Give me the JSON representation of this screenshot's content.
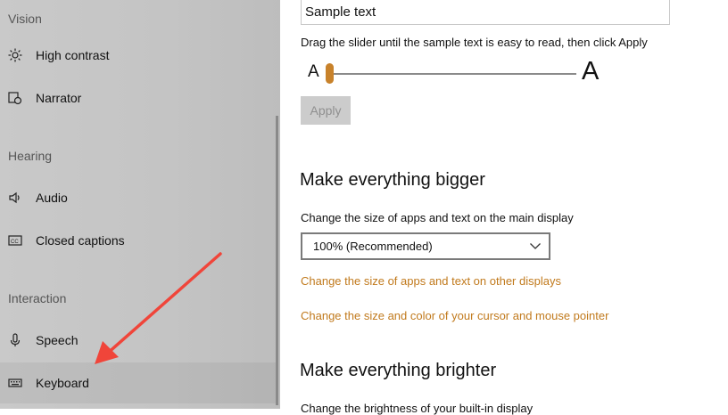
{
  "sidebar": {
    "sections": {
      "vision": "Vision",
      "hearing": "Hearing",
      "interaction": "Interaction"
    },
    "items": [
      {
        "label": "High contrast",
        "icon": "sun-icon"
      },
      {
        "label": "Narrator",
        "icon": "narrator-icon"
      },
      {
        "label": "Audio",
        "icon": "speaker-icon"
      },
      {
        "label": "Closed captions",
        "icon": "cc-icon"
      },
      {
        "label": "Speech",
        "icon": "microphone-icon"
      },
      {
        "label": "Keyboard",
        "icon": "keyboard-icon"
      }
    ],
    "selected": "Keyboard"
  },
  "main": {
    "sample_text": "Sample text",
    "instruction": "Drag the slider until the sample text is easy to read, then click Apply",
    "slider": {
      "small_label": "A",
      "large_label": "A",
      "value_fraction": 0.0
    },
    "apply_label": "Apply",
    "bigger": {
      "heading": "Make everything bigger",
      "label": "Change the size of apps and text on the main display",
      "dropdown_value": "100% (Recommended)",
      "link1": "Change the size of apps and text on other displays",
      "link2": "Change the size and color of your cursor and mouse pointer"
    },
    "brighter": {
      "heading": "Make everything brighter",
      "label": "Change the brightness of your built-in display"
    }
  },
  "colors": {
    "accent": "#c17a1d",
    "annotation_arrow": "#f0453a"
  }
}
